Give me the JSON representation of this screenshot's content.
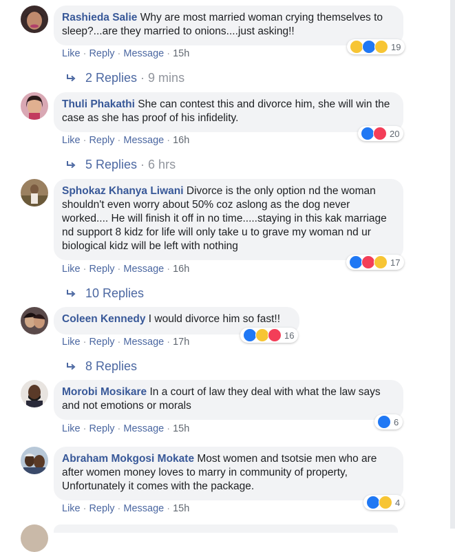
{
  "comments": [
    {
      "author": "Rashieda Salie",
      "text": "Why are most married woman crying themselves to sleep?...are they married to onions....just asking!!",
      "actions": {
        "like": "Like",
        "reply": "Reply",
        "message": "Message",
        "time": "15h"
      },
      "reactions": [
        "haha",
        "like",
        "wow"
      ],
      "reaction_count": "19",
      "replies": {
        "label": "2 Replies",
        "time": "9 mins"
      }
    },
    {
      "author": "Thuli Phakathi",
      "text": "She can contest this and divorce him, she will win the case as she has proof of his infidelity.",
      "actions": {
        "like": "Like",
        "reply": "Reply",
        "message": "Message",
        "time": "16h"
      },
      "reactions": [
        "like",
        "love"
      ],
      "reaction_count": "20",
      "replies": {
        "label": "5 Replies",
        "time": "6 hrs"
      }
    },
    {
      "author": "Sphokaz Khanya Liwani",
      "text": "Divorce is the only option nd the woman shouldn't even worry about 50% coz aslong as the dog never worked.... He will finish it off in no time.....staying in this kak marriage nd support 8 kidz for life will only take u to grave my woman nd ur biological kidz will be left with nothing",
      "actions": {
        "like": "Like",
        "reply": "Reply",
        "message": "Message",
        "time": "16h"
      },
      "reactions": [
        "like",
        "love",
        "wow"
      ],
      "reaction_count": "17",
      "replies": {
        "label": "10 Replies",
        "time": ""
      }
    },
    {
      "author": "Coleen Kennedy",
      "text": "I would divorce him so fast!!",
      "actions": {
        "like": "Like",
        "reply": "Reply",
        "message": "Message",
        "time": "17h"
      },
      "reactions": [
        "like",
        "haha",
        "love"
      ],
      "reaction_count": "16",
      "replies": {
        "label": "8 Replies",
        "time": ""
      }
    },
    {
      "author": "Morobi Mosikare",
      "text": "In a court of law they deal with what the law says and not emotions or morals",
      "actions": {
        "like": "Like",
        "reply": "Reply",
        "message": "Message",
        "time": "15h"
      },
      "reactions": [
        "like"
      ],
      "reaction_count": "6",
      "replies": null
    },
    {
      "author": "Abraham Mokgosi Mokate",
      "text": "Most women and tsotsie men who are after women money loves to marry in community of property, Unfortunately it comes with the package.",
      "actions": {
        "like": "Like",
        "reply": "Reply",
        "message": "Message",
        "time": "15h"
      },
      "reactions": [
        "like",
        "sad"
      ],
      "reaction_count": "4",
      "replies": null
    }
  ],
  "colors": {
    "author": "#385898",
    "link": "#4b67a1",
    "bubble": "#f2f3f5",
    "meta": "#90949c"
  }
}
